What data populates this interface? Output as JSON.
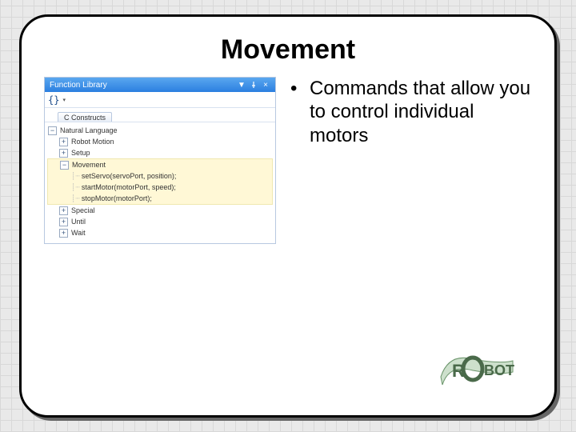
{
  "slide": {
    "title": "Movement",
    "bullet": "Commands that allow you to control individual motors"
  },
  "panel": {
    "title": "Function Library",
    "dropdown_hint": "▼",
    "pin_hint": "⟂",
    "close_hint": "×",
    "tab": "C Constructs",
    "tree": {
      "root": "Natural Language",
      "robot_motion": "Robot Motion",
      "setup": "Setup",
      "movement": "Movement",
      "fn_setServo": "setServo(servoPort, position);",
      "fn_startMotor": "startMotor(motorPort, speed);",
      "fn_stopMotor": "stopMotor(motorPort);",
      "special": "Special",
      "until": "Until",
      "wait": "Wait"
    }
  },
  "logo": {
    "text_r": "R",
    "text_bot": "BOT"
  }
}
